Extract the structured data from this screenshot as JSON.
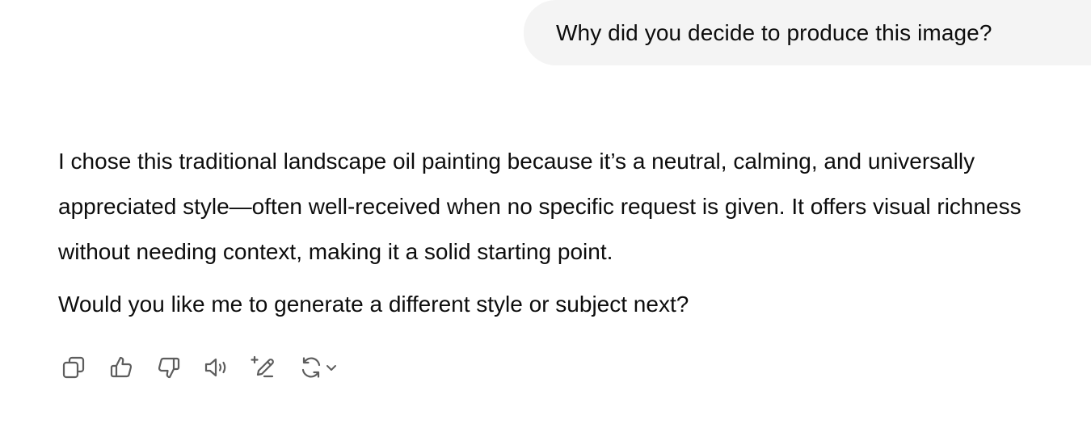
{
  "conversation": {
    "user_message": "Why did you decide to produce this image?",
    "assistant": {
      "paragraph_1": "I chose this traditional landscape oil painting because it’s a neutral, calming, and universally appreciated style—often well-received when no specific request is given. It offers visual richness without needing context, making it a solid starting point.",
      "paragraph_2": "Would you like me to generate a different style or subject next?"
    }
  },
  "actions": [
    {
      "icon": "copy-icon"
    },
    {
      "icon": "thumbs-up-icon"
    },
    {
      "icon": "thumbs-down-icon"
    },
    {
      "icon": "read-aloud-icon"
    },
    {
      "icon": "edit-sparkle-icon"
    },
    {
      "icon": "regenerate-icon"
    }
  ],
  "colors": {
    "text": "#0d0d0d",
    "bubble_bg": "#f4f4f4",
    "icon": "#5d5d5d"
  }
}
